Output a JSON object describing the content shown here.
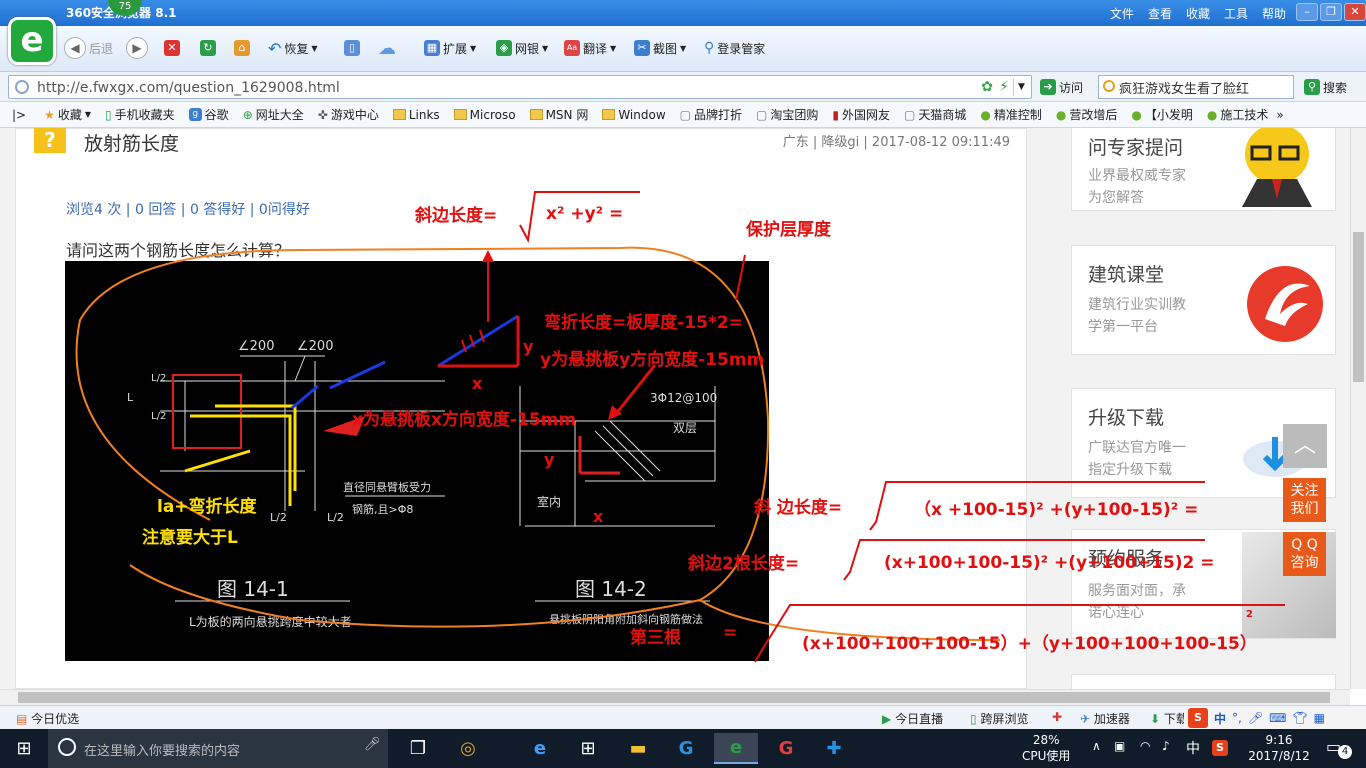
{
  "browser": {
    "title": "360安全浏览器 8.1",
    "badge": "75",
    "logo": "e",
    "menus": [
      "文件",
      "查看",
      "收藏",
      "工具",
      "帮助"
    ],
    "nav": {
      "back": "后退",
      "restore": "恢复",
      "extend": "扩展",
      "bank": "网银",
      "translate": "翻译",
      "screenshot": "截图",
      "login": "登录管家"
    },
    "url": "http://e.fwxgx.com/question_1629008.html",
    "visit": "访问",
    "search_value": "疯狂游戏女生看了脸红",
    "search_btn": "搜索",
    "favorites": [
      "收藏",
      "手机收藏夹",
      "谷歌",
      "网址大全",
      "游戏中心",
      "Links",
      "Microso",
      "MSN 网",
      "Window",
      "品牌打折",
      "淘宝团购",
      "外国网友",
      "天猫商城",
      "精准控制",
      "营改增后",
      "【小发明",
      "施工技术"
    ]
  },
  "page": {
    "title": "放射筋长度",
    "meta": "广东 | 降级gi | 2017-08-12 09:11:49",
    "stats": "浏览4 次 | 0 回答 | 0 答得好 | 0问得好",
    "question": "请问这两个钢筋长度怎么计算？"
  },
  "cad": {
    "dim1": "∠200",
    "dim2": "∠200",
    "L": "L",
    "L2a": "L/2",
    "L2b": "L/2",
    "L2c": "L/2",
    "L2d": "L/2",
    "label_bar": "3Φ12@100",
    "label_double": "双层",
    "label_indoor": "室内",
    "label_dia1": "直径同悬臂板受力",
    "label_dia2": "钢筋,且>Φ8",
    "fig1": "图 14-1",
    "fig2": "图 14-2",
    "cap1": "L为板的两向悬挑跨度中较大者",
    "cap2": "悬挑板阴阳角附加斜向钢筋做法"
  },
  "annotations": {
    "hyp_label": "斜边长度=",
    "hyp_formula": "x² +y²  =",
    "cover": "保护层厚度",
    "bend": "弯折长度=板厚度-15*2=",
    "ydef": "y为悬挑板y方向宽度-15mm",
    "xdef": "x为悬挑板x方向宽度-15mm",
    "la": "la+弯折长度",
    "note": "注意要大于L",
    "x": "x",
    "y": "y",
    "hyp2_label": "斜  边长度=",
    "hyp2_formula": "（x +100-15)² +(y+100-15)²  =",
    "two_label": "斜边2根长度=",
    "two_formula": "(x+100+100-15)² +(y+100+15)2 =",
    "third_label": "第三根",
    "third_eq": "=",
    "third_formula": "(x+100+100+100-15）+（y+100+100+100-15）",
    "two_small": "2"
  },
  "sidebar": [
    {
      "title": "问专家提问",
      "sub": [
        "业界最权威专家",
        "为您解答"
      ]
    },
    {
      "title": "建筑课堂",
      "sub": [
        "建筑行业实训教",
        "学第一平台"
      ]
    },
    {
      "title": "升级下载",
      "sub": [
        "广联达官方唯一",
        "指定升级下载"
      ]
    },
    {
      "title": "预约服务",
      "sub": [
        "服务面对面，承",
        "诺心连心"
      ]
    }
  ],
  "float": {
    "follow": "关注\n我们",
    "qq": "Q Q\n咨询"
  },
  "status": {
    "today": "今日优选",
    "live": "今日直播",
    "cross": "跨屏浏览",
    "accel": "加速器",
    "download": "下载"
  },
  "taskbar": {
    "search_placeholder": "在这里输入你要搜索的内容",
    "cpu": "28%",
    "cpu_label": "CPU使用",
    "ime": "中",
    "time": "9:16",
    "date": "2017/8/12",
    "notif": "4"
  },
  "colors": {
    "accent": "#1f6fd1",
    "annotation": "#e01010",
    "highlight": "#ffe000",
    "orange": "#f08020"
  }
}
